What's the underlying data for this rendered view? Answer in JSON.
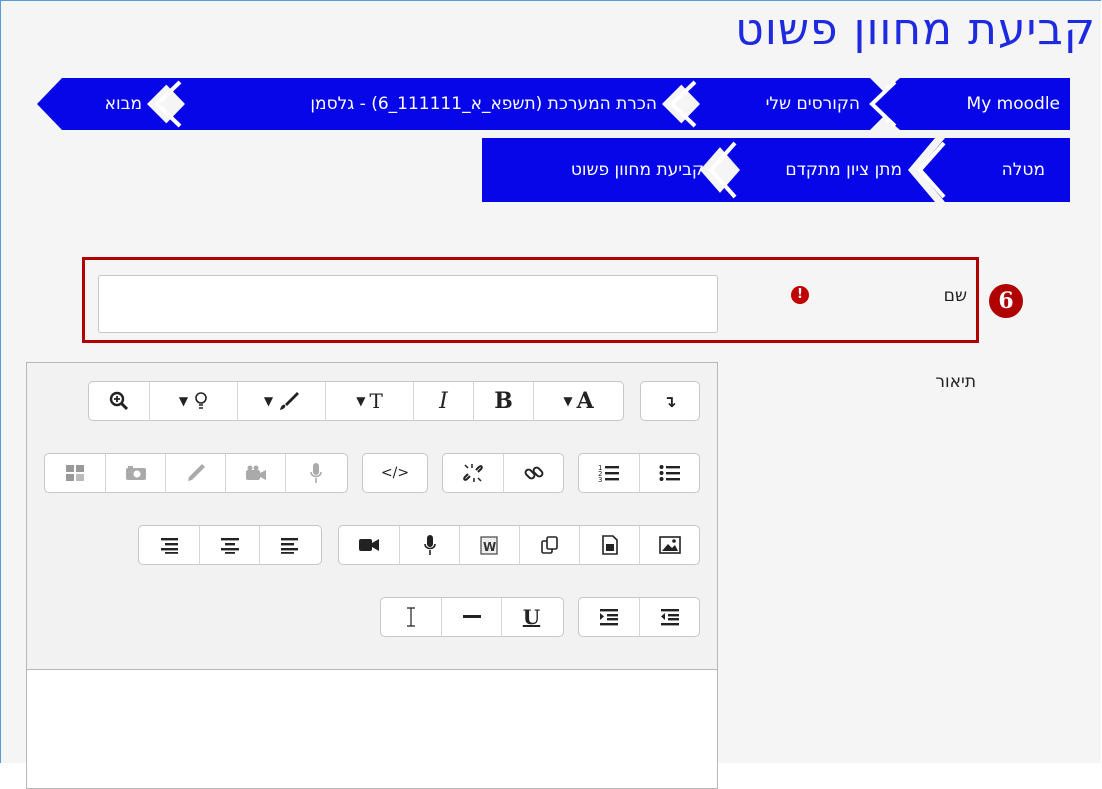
{
  "page_title": "קביעת מחוון פשוט",
  "breadcrumb": {
    "row1": [
      "My moodle",
      "הקורסים שלי",
      "הכרת המערכת (תשפא_א_111111_6) - גלסמן",
      "מבוא"
    ],
    "row2": [
      "מטלה",
      "מתן ציון מתקדם",
      "קביעת מחוון פשוט"
    ]
  },
  "form": {
    "name_label": "שם",
    "name_value": "",
    "required_icon": "!",
    "description_label": "תיאור",
    "step_number": "6"
  },
  "colors": {
    "breadcrumb": "#0606e8",
    "title": "#1e2ae0",
    "highlight": "#b00000"
  },
  "toolbar_icons": {
    "row1": [
      "toolbar-toggle-icon",
      "font-color-icon",
      "bold-icon",
      "italic-icon",
      "font-size-icon",
      "background-color-icon",
      "accessibility-icon",
      "zoom-icon"
    ],
    "row2": [
      "unordered-list-icon",
      "ordered-list-icon",
      "link-icon",
      "unlink-icon",
      "html-source-icon",
      "record-audio-icon",
      "record-video-icon",
      "drawing-icon",
      "screenshot-icon",
      "table-icon"
    ],
    "row3": [
      "image-icon",
      "media-icon",
      "manage-files-icon",
      "paste-word-icon",
      "microphone-icon",
      "video-camera-icon",
      "align-right-icon",
      "align-center-icon",
      "align-left-icon"
    ],
    "row4": [
      "outdent-icon",
      "indent-icon",
      "underline-icon",
      "horizontal-rule-icon",
      "clear-format-icon"
    ]
  },
  "toolbar_glyphs": {
    "bold": "B",
    "italic": "I",
    "font": "A",
    "underline": "U",
    "size": "T",
    "source": "</>"
  }
}
